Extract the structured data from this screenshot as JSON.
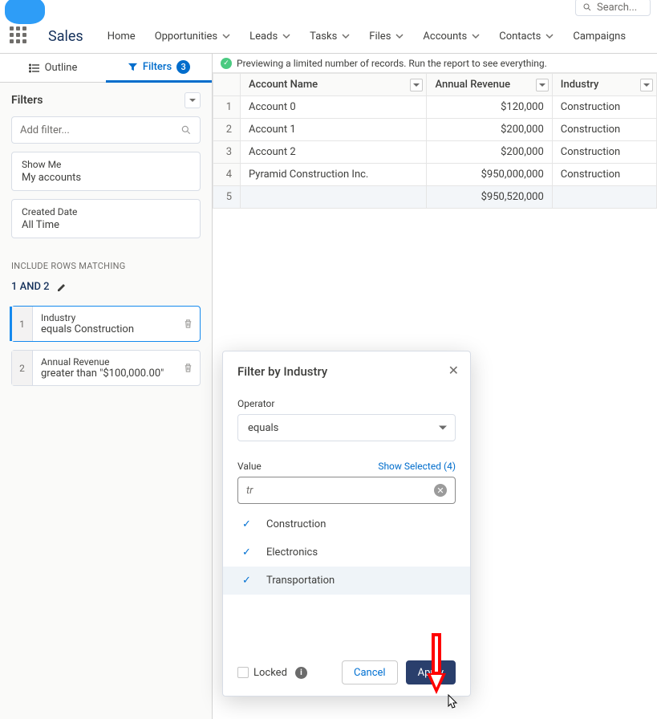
{
  "search_placeholder": "Search...",
  "app_name": "Sales",
  "nav": [
    "Home",
    "Opportunities",
    "Leads",
    "Tasks",
    "Files",
    "Accounts",
    "Contacts",
    "Campaigns"
  ],
  "tabs": {
    "outline": "Outline",
    "filters": "Filters",
    "count": "3"
  },
  "filters_heading": "Filters",
  "add_filter_placeholder": "Add filter...",
  "showme": {
    "lbl": "Show Me",
    "val": "My accounts"
  },
  "created": {
    "lbl": "Created Date",
    "val": "All Time"
  },
  "include_label": "INCLUDE ROWS MATCHING",
  "logic": "1 AND 2",
  "frows": [
    {
      "n": "1",
      "lbl": "Industry",
      "val": "equals Construction"
    },
    {
      "n": "2",
      "lbl": "Annual Revenue",
      "val": "greater than \"$100,000.00\""
    }
  ],
  "preview_msg": "Previewing a limited number of records. Run the report to see everything.",
  "cols": {
    "acct": "Account Name",
    "rev": "Annual Revenue",
    "ind": "Industry"
  },
  "rows": [
    {
      "n": "1",
      "a": "Account 0",
      "r": "$120,000",
      "i": "Construction"
    },
    {
      "n": "2",
      "a": "Account 1",
      "r": "$200,000",
      "i": "Construction"
    },
    {
      "n": "3",
      "a": "Account 2",
      "r": "$200,000",
      "i": "Construction"
    },
    {
      "n": "4",
      "a": "Pyramid Construction Inc.",
      "r": "$950,000,000",
      "i": "Construction"
    },
    {
      "n": "5",
      "a": "",
      "r": "$950,520,000",
      "i": ""
    }
  ],
  "pop": {
    "title": "Filter by Industry",
    "operator_lbl": "Operator",
    "operator_val": "equals",
    "value_lbl": "Value",
    "show_selected": "Show Selected (4)",
    "input": "tr",
    "opts": [
      "Construction",
      "Electronics",
      "Transportation"
    ],
    "locked": "Locked",
    "cancel": "Cancel",
    "apply": "Apply"
  }
}
